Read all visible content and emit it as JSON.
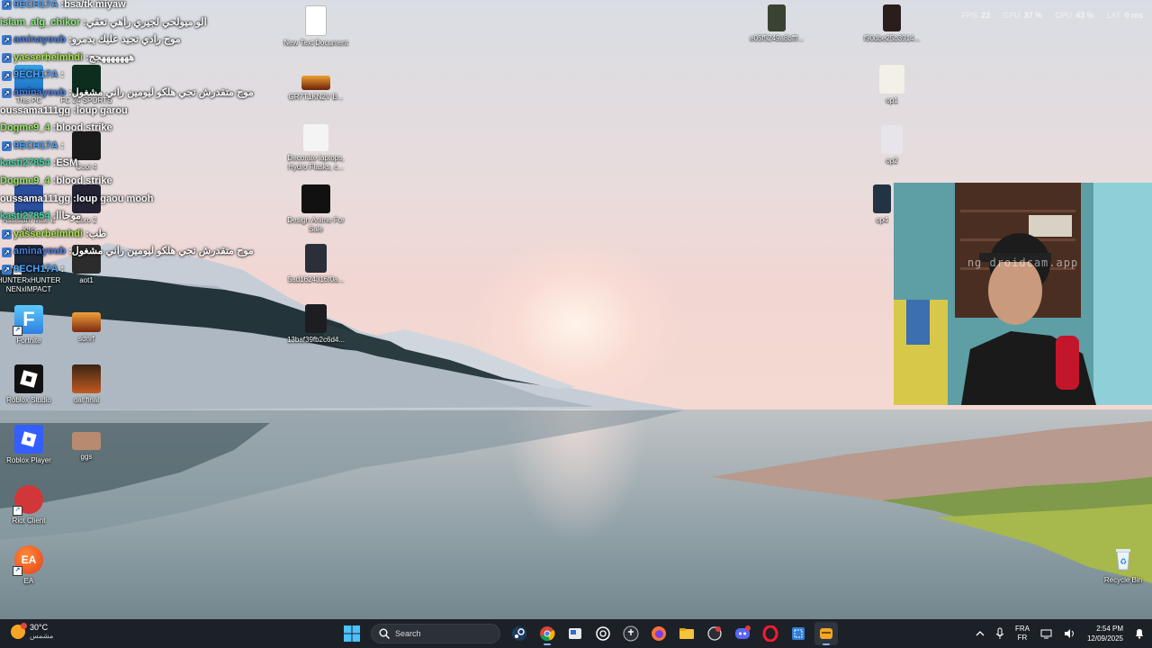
{
  "hud": {
    "fps_label": "FPS",
    "fps": "23",
    "gpu_label": "GPU",
    "gpu": "37 %",
    "cpu_label": "CPU",
    "cpu": "43 %",
    "lat_label": "LAT",
    "lat": "0 ms"
  },
  "chat": [
    {
      "user": "9ECH17A",
      "user_color": "#4fa3ff",
      "badge": true,
      "text": "bsa/tk miyaw"
    },
    {
      "user": "islam_alg_chikor",
      "user_color": "#8cf07a",
      "badge": false,
      "text": "الو ميولحي لجيري راهي تعقي"
    },
    {
      "user": "aminayoub",
      "user_color": "#4a7de0",
      "badge": true,
      "text": "موح رادي تجيد عليك يدمرو"
    },
    {
      "user": "yasserbelmhdi",
      "user_color": "#a8e64a",
      "badge": true,
      "text": "هههههههجج"
    },
    {
      "user": "9ECH17A",
      "user_color": "#4fa3ff",
      "badge": true,
      "text": ""
    },
    {
      "user": "aminayoub",
      "user_color": "#4a7de0",
      "badge": true,
      "text": "موح متقدرش تجي هلكو ليومين راني مشغول"
    },
    {
      "user": "oussama111gg",
      "user_color": "#ffffff",
      "badge": false,
      "text": "loup garou"
    },
    {
      "user": "Dogme9_4",
      "user_color": "#9be86a",
      "badge": false,
      "text": "blood strike"
    },
    {
      "user": "9ECH17A",
      "user_color": "#4fa3ff",
      "badge": true,
      "text": ""
    },
    {
      "user": "kasti27854",
      "user_color": "#3ed8a8",
      "badge": false,
      "text": "ESM"
    },
    {
      "user": "Dogme9_4",
      "user_color": "#9be86a",
      "badge": false,
      "text": "blood strike"
    },
    {
      "user": "oussama111gg",
      "user_color": "#ffffff",
      "badge": false,
      "text": "loup gaou mooh"
    },
    {
      "user": "kasti27854",
      "user_color": "#3ed8a8",
      "badge": false,
      "text": "موحااا"
    },
    {
      "user": "yasserbelmhdi",
      "user_color": "#a8e64a",
      "badge": true,
      "text": "طب"
    },
    {
      "user": "aminayoub",
      "user_color": "#4a7de0",
      "badge": true,
      "text": "موح متقدرش تجي هلكو ليومين راني مشغول"
    },
    {
      "user": "9ECH17A",
      "user_color": "#4fa3ff",
      "badge": true,
      "text": ""
    }
  ],
  "desktop_icons": [
    {
      "label": "This PC",
      "icon": "this-pc-icon"
    },
    {
      "label": "FC 24 SPORTS",
      "icon": "game-icon"
    },
    {
      "label": "Cool 4",
      "icon": "image-icon"
    },
    {
      "label": "Assistant Mise à jour",
      "icon": "assistant-icon"
    },
    {
      "label": "Zoro 2",
      "icon": "image-icon"
    },
    {
      "label": "HUNTERxHUNTER NENxIMPACT",
      "icon": "game-icon"
    },
    {
      "label": "aot1",
      "icon": "image-icon"
    },
    {
      "label": "Fortnite",
      "icon": "fortnite-icon"
    },
    {
      "label": "sdnrf",
      "icon": "image-icon"
    },
    {
      "label": "Roblox Studio",
      "icon": "roblox-studio-icon"
    },
    {
      "label": "oat final",
      "icon": "image-icon"
    },
    {
      "label": "Roblox Player",
      "icon": "roblox-player-icon"
    },
    {
      "label": "ggs",
      "icon": "image-icon"
    },
    {
      "label": "Riot Client",
      "icon": "riot-client-icon"
    },
    {
      "label": "EA",
      "icon": "ea-icon"
    },
    {
      "label": "New Text Document",
      "icon": "text-document-icon"
    },
    {
      "label": "GR7T1KN2V B...",
      "icon": "image-icon"
    },
    {
      "label": "Decorate laptops, Hydro Flasks, c...",
      "icon": "image-icon"
    },
    {
      "label": "Design Anime For Sale",
      "icon": "image-icon"
    },
    {
      "label": "5ad1624316f0a...",
      "icon": "image-icon"
    },
    {
      "label": "13baf39fb2c6d4...",
      "icon": "image-icon"
    },
    {
      "label": "e05f5249a8bfff...",
      "icon": "image-icon"
    },
    {
      "label": "f90dbe25b3914...",
      "icon": "image-icon"
    },
    {
      "label": "op1",
      "icon": "image-icon"
    },
    {
      "label": "op2",
      "icon": "image-icon"
    },
    {
      "label": "op4",
      "icon": "image-icon"
    },
    {
      "label": "Recycle Bin",
      "icon": "recycle-bin-icon"
    }
  ],
  "webcam": {
    "watermark": "ng droidcam.app"
  },
  "taskbar": {
    "weather_temp": "30°C",
    "weather_desc": "مشمس",
    "search_placeholder": "Search",
    "apps": [
      "start-icon",
      "search",
      "steam-icon",
      "chrome-icon",
      "task-view-icon",
      "chatgpt-icon",
      "app-icon",
      "firefox-icon",
      "file-explorer-icon",
      "brawl-icon",
      "discord-icon",
      "opera-icon",
      "snipping-tool-icon",
      "active-app-icon"
    ],
    "lang_top": "FRA",
    "lang_bottom": "FR",
    "time": "2:54 PM",
    "date": "12/09/2025"
  },
  "colors": {
    "taskbar": "#1c2128",
    "accent": "#8ab4f8"
  }
}
